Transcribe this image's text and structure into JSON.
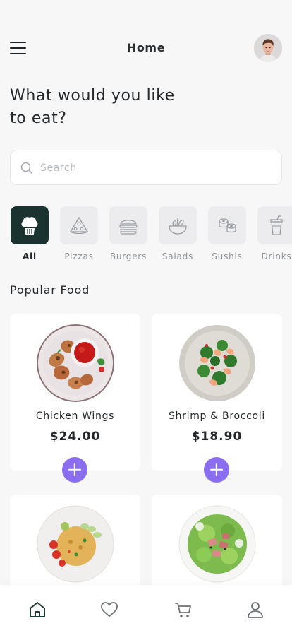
{
  "header": {
    "title": "Home",
    "menu_icon": "hamburger-menu-icon",
    "avatar_icon": "user-avatar"
  },
  "headline": "What would you like to eat?",
  "search": {
    "placeholder": "Search",
    "icon": "search-icon"
  },
  "categories": [
    {
      "label": "All",
      "icon": "chef-hat-icon",
      "active": true
    },
    {
      "label": "Pizzas",
      "icon": "pizza-slice-icon",
      "active": false
    },
    {
      "label": "Burgers",
      "icon": "burger-icon",
      "active": false
    },
    {
      "label": "Salads",
      "icon": "salad-bowl-icon",
      "active": false
    },
    {
      "label": "Sushis",
      "icon": "sushi-icon",
      "active": false
    },
    {
      "label": "Drinks",
      "icon": "drink-cup-icon",
      "active": false
    }
  ],
  "popular": {
    "title": "Popular Food",
    "items": [
      {
        "name": "Chicken Wings",
        "price": "$24.00"
      },
      {
        "name": "Shrimp & Broccoli",
        "price": "$18.90"
      },
      {
        "name": "",
        "price": ""
      },
      {
        "name": "",
        "price": ""
      }
    ]
  },
  "nav": [
    {
      "icon": "home-icon",
      "active": true
    },
    {
      "icon": "heart-icon",
      "active": false
    },
    {
      "icon": "cart-icon",
      "active": false
    },
    {
      "icon": "profile-icon",
      "active": false
    }
  ],
  "colors": {
    "accent": "#8b6df0",
    "category_active": "#1b3330",
    "background": "#f7f7f8"
  }
}
